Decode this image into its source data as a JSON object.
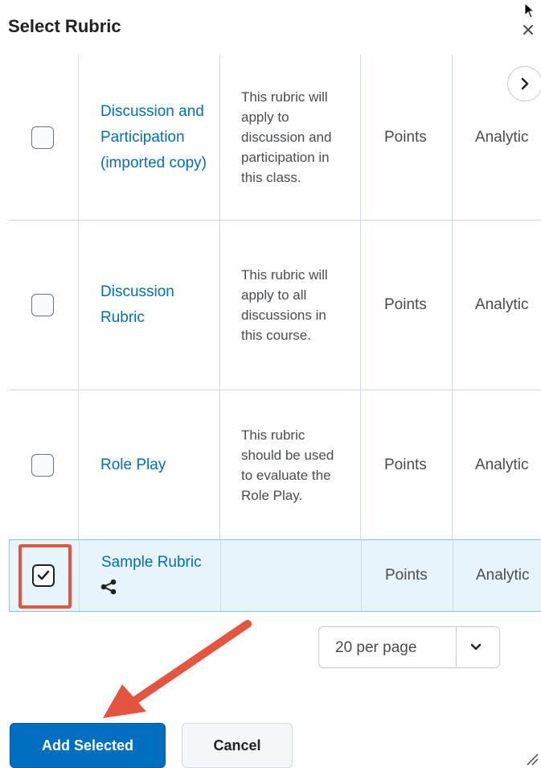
{
  "dialog": {
    "title": "Select Rubric"
  },
  "rubrics": [
    {
      "name": "Discussion and Participation (imported copy)",
      "description": "This rubric will apply to discussion and participation in this class.",
      "scoring": "Points",
      "type": "Analytic",
      "checked": false
    },
    {
      "name": "Discussion Rubric",
      "description": "This rubric will apply to all discussions in this course.",
      "scoring": "Points",
      "type": "Analytic",
      "checked": false
    },
    {
      "name": "Role Play",
      "description": "This rubric should be used to evaluate the Role Play.",
      "scoring": "Points",
      "type": "Analytic",
      "checked": false
    },
    {
      "name": "Sample Rubric",
      "description": "",
      "scoring": "Points",
      "type": "Analytic",
      "checked": true,
      "shared": true
    }
  ],
  "pagination": {
    "per_page": "20 per page"
  },
  "actions": {
    "add_selected": "Add Selected",
    "cancel": "Cancel"
  },
  "colors": {
    "link": "#006fbf",
    "primary": "#006fbf",
    "annotation": "#e4543f",
    "selected_row": "#e8f4fb"
  },
  "icons": [
    "close-icon",
    "chevron-right-icon",
    "chevron-down-icon",
    "share-icon",
    "checkmark-icon",
    "resize-handle-icon"
  ]
}
